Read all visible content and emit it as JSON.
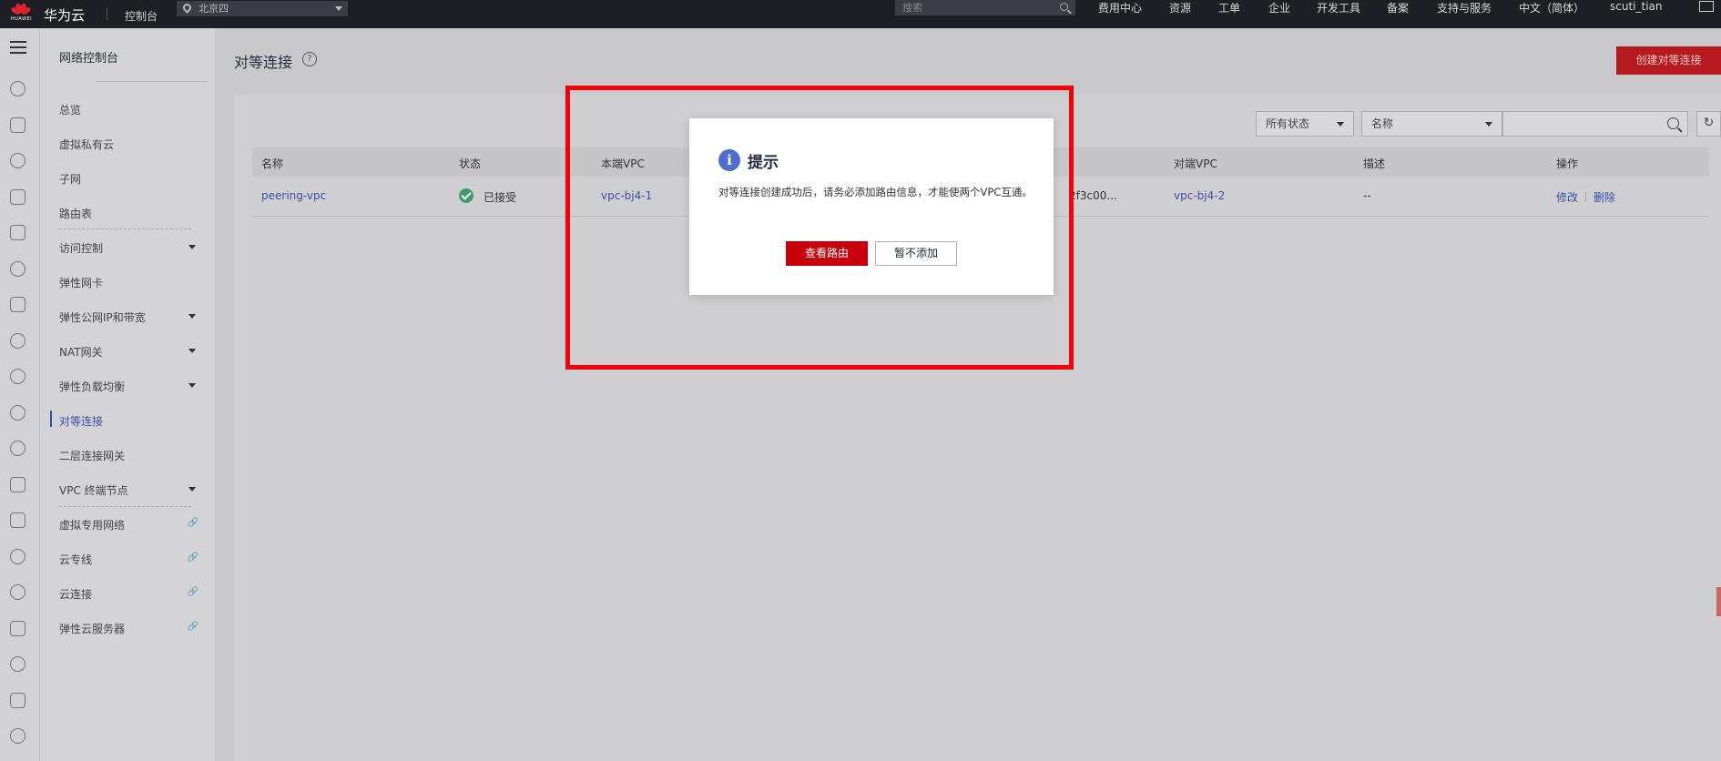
{
  "topbar": {
    "logo_text": "HUAWEI",
    "brand": "华为云",
    "console": "控制台",
    "region": "北京四",
    "search_placeholder": "搜索",
    "nav": [
      "费用中心",
      "资源",
      "工单",
      "企业",
      "开发工具",
      "备案",
      "支持与服务",
      "中文（简体）",
      "scuti_tian"
    ]
  },
  "sidebar": {
    "title": "网络控制台",
    "items": [
      {
        "label": "总览"
      },
      {
        "label": "虚拟私有云"
      },
      {
        "label": "子网"
      },
      {
        "label": "路由表"
      },
      {
        "label": "访问控制"
      },
      {
        "label": "弹性网卡"
      },
      {
        "label": "弹性公网IP和带宽"
      },
      {
        "label": "NAT网关"
      },
      {
        "label": "弹性负载均衡"
      },
      {
        "label": "对等连接"
      },
      {
        "label": "二层连接网关"
      },
      {
        "label": "VPC 终端节点"
      },
      {
        "label": "虚拟专用网络"
      },
      {
        "label": "云专线"
      },
      {
        "label": "云连接"
      },
      {
        "label": "弹性云服务器"
      }
    ]
  },
  "main": {
    "title": "对等连接",
    "help": "?",
    "create_button": "创建对等连接",
    "filter_status": "所有状态",
    "filter_field": "名称",
    "search_value": "",
    "refresh": "↻",
    "columns": [
      "名称",
      "状态",
      "本端VPC",
      "对端VPC",
      "描述",
      "操作"
    ],
    "row": {
      "name": "peering-vpc",
      "status": "已接受",
      "local_vpc": "vpc-bj4-1",
      "peer_id_fragment": "2f3c00...",
      "peer_vpc": "vpc-bj4-2",
      "description": "--",
      "action_edit": "修改",
      "action_delete": "删除"
    }
  },
  "modal": {
    "icon": "i",
    "title": "提示",
    "message": "对等连接创建成功后，请务必添加路由信息，才能使两个VPC互通。",
    "primary_button": "查看路由",
    "secondary_button": "暂不添加"
  },
  "colors": {
    "brand_red": "#c7000b",
    "highlight_red": "#f40008",
    "info_blue": "#4f6dcc",
    "success_green": "#3f9d6a",
    "link_blue": "#3c4fa8"
  }
}
